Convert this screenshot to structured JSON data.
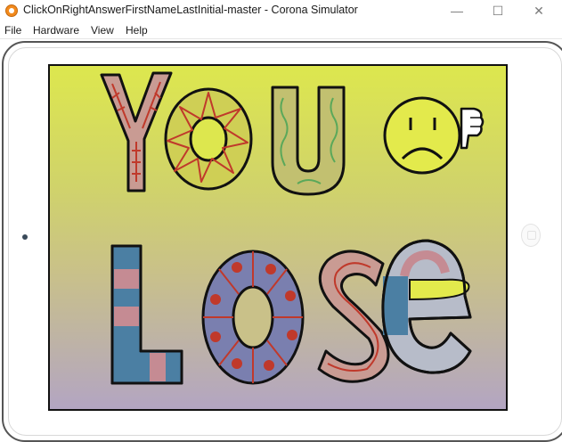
{
  "window": {
    "title": "ClickOnRightAnswerFirstNameLastInitial-master - Corona Simulator",
    "minimize_glyph": "—",
    "maximize_glyph": "☐",
    "close_glyph": "✕"
  },
  "menu": {
    "items": [
      "File",
      "Hardware",
      "View",
      "Help"
    ]
  },
  "colors": {
    "screen_top": "#dde74e",
    "screen_bottom": "#b3a5c2",
    "letter_outline": "#111111",
    "accent_red": "#c0392b"
  },
  "icons": {
    "app": "corona-icon",
    "face": "sad-face-icon",
    "thumb": "thumbs-down-icon"
  }
}
